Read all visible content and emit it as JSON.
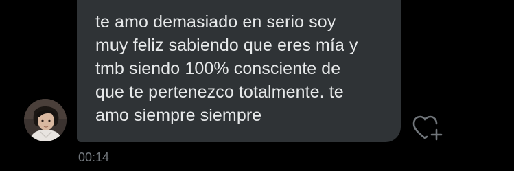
{
  "message": {
    "text": "te amo demasiado en serio soy\nmuy feliz sabiendo que eres mía y\ntmb siendo 100% consciente de\nque te pertenezco totalmente. te\namo siempre siempre",
    "timestamp": "00:14"
  },
  "icons": {
    "avatar": "user-avatar",
    "reaction": "heart-plus-icon"
  },
  "colors": {
    "background": "#000000",
    "bubble": "#2f3336",
    "text": "#e7e9ea",
    "muted": "#71767b"
  }
}
